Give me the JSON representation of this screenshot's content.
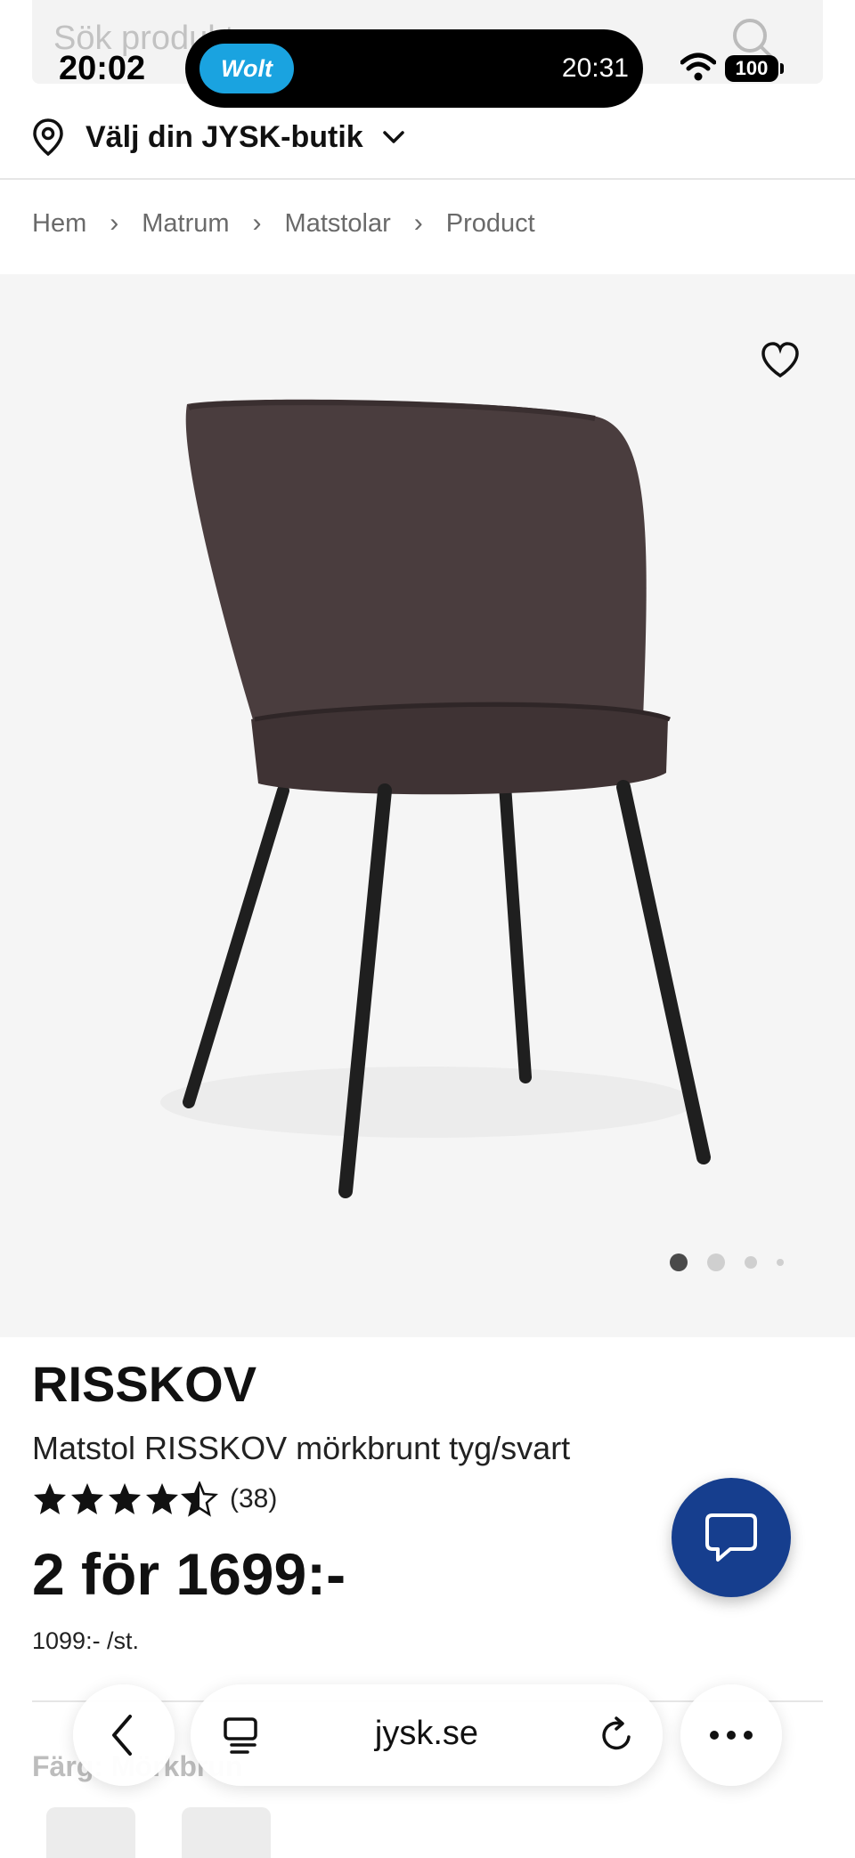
{
  "search": {
    "placeholder": "Sök produkter, rum..."
  },
  "status_bar": {
    "time": "20:02",
    "app_badge": "Wolt",
    "island_time": "20:31",
    "battery": "100"
  },
  "store": {
    "label": "Välj din JYSK-butik"
  },
  "breadcrumb": [
    "Hem",
    "Matrum",
    "Matstolar",
    "Product"
  ],
  "product": {
    "brand": "RISSKOV",
    "name": "Matstol RISSKOV mörkbrunt tyg/svart",
    "rating": 4.5,
    "rating_count": "(38)",
    "price": "2 för 1699:-",
    "unit_price": "1099:- /st.",
    "color_label": "Färg: Mörkbrun",
    "image_count": 4,
    "active_image": 1
  },
  "browser": {
    "url": "jysk.se"
  },
  "colors": {
    "chat": "#163e8e",
    "wolt": "#1aa3e0",
    "image_bg": "#f5f5f5"
  },
  "icons": [
    "search-icon",
    "location-pin-icon",
    "chevron-down-icon",
    "chevron-right-icon",
    "heart-icon",
    "star-icon",
    "chat-icon",
    "back-icon",
    "tabs-icon",
    "reload-icon",
    "more-icon",
    "wifi-icon"
  ]
}
